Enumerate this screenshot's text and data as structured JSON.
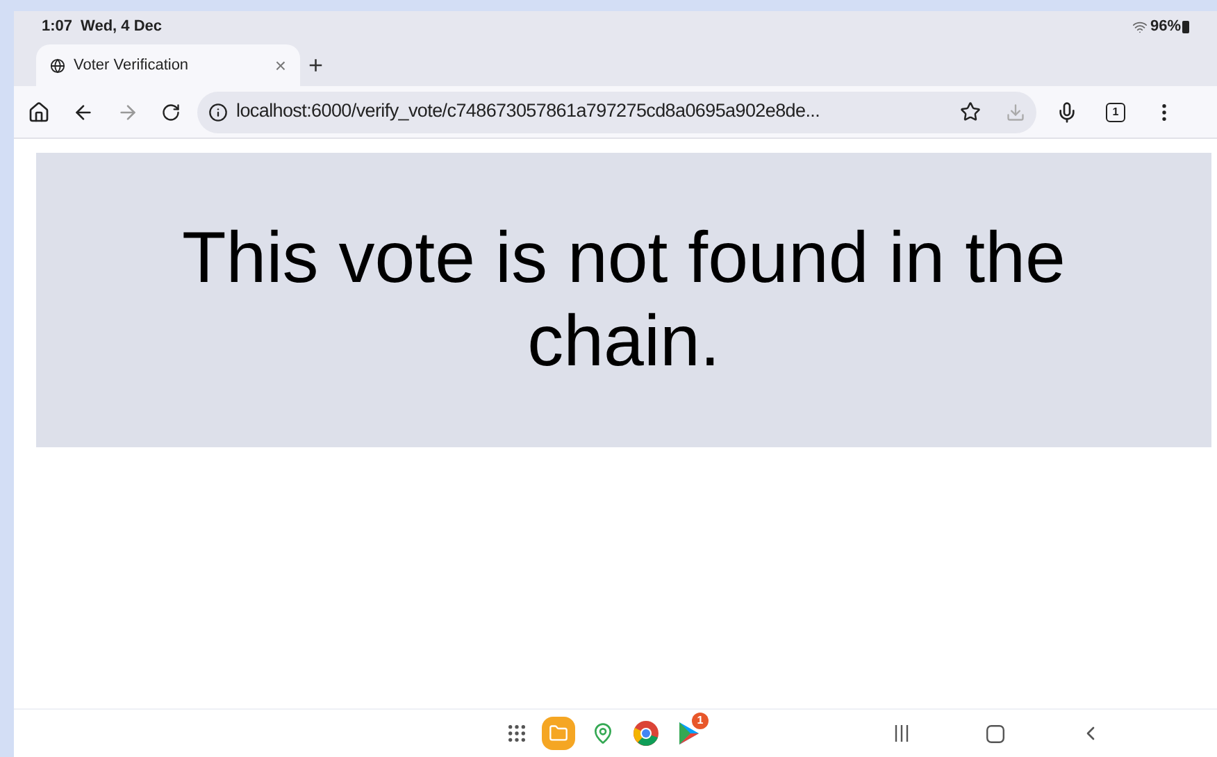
{
  "status_bar": {
    "time": "1:07",
    "date": "Wed, 4 Dec",
    "battery": "96%"
  },
  "tabs": [
    {
      "title": "Voter Verification",
      "selected": true,
      "close": "×"
    }
  ],
  "new_tab": "+",
  "toolbar": {
    "url": "localhost:6000/verify_vote/c748673057861a797275cd8a0695a902e8de...",
    "tab_count": "1"
  },
  "page": {
    "message": "This vote is not found in the chain."
  },
  "taskbar": {
    "store_badge": "1"
  }
}
